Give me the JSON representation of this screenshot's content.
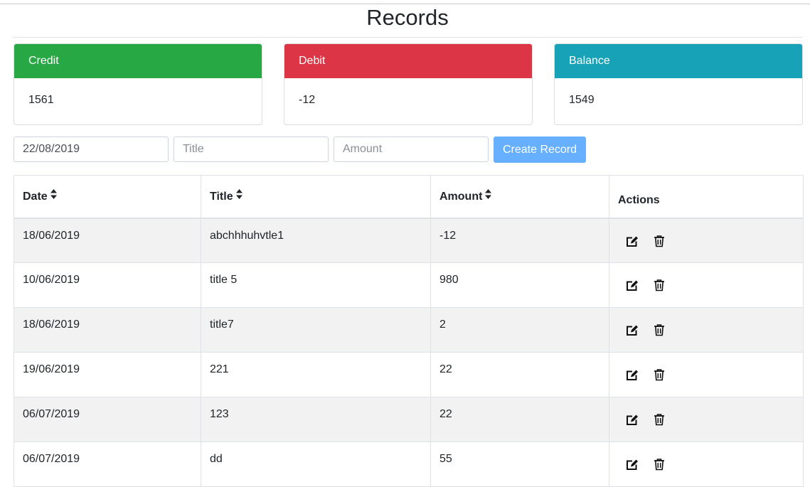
{
  "page": {
    "title": "Records"
  },
  "cards": {
    "credit": {
      "label": "Credit",
      "value": "1561",
      "color": "#28a745"
    },
    "debit": {
      "label": "Debit",
      "value": "-12",
      "color": "#dc3545"
    },
    "balance": {
      "label": "Balance",
      "value": "1549",
      "color": "#17a2b8"
    }
  },
  "form": {
    "date_value": "22/08/2019",
    "title_placeholder": "Title",
    "amount_placeholder": "Amount",
    "create_label": "Create Record",
    "create_color": "#66b0ff"
  },
  "table": {
    "headers": {
      "date": "Date",
      "title": "Title",
      "amount": "Amount",
      "actions": "Actions"
    },
    "sort_icon": "sort-icon",
    "row_actions": [
      "edit-icon",
      "trash-icon"
    ],
    "rows": [
      {
        "date": "18/06/2019",
        "title": "abchhhuhvtle1",
        "amount": "-12"
      },
      {
        "date": "10/06/2019",
        "title": "title 5",
        "amount": "980"
      },
      {
        "date": "18/06/2019",
        "title": "title7",
        "amount": "2"
      },
      {
        "date": "19/06/2019",
        "title": "221",
        "amount": "22"
      },
      {
        "date": "06/07/2019",
        "title": "123",
        "amount": "22"
      },
      {
        "date": "06/07/2019",
        "title": "dd",
        "amount": "55"
      }
    ]
  }
}
